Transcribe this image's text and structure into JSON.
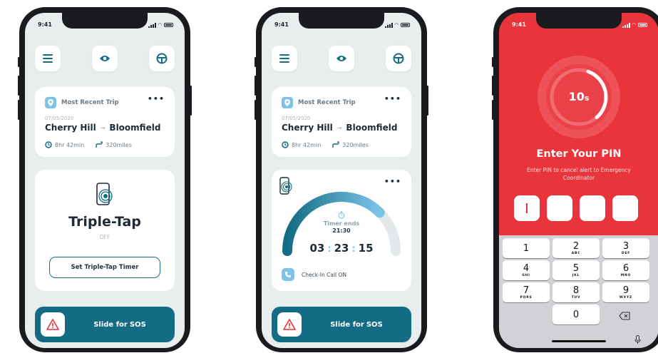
{
  "status": {
    "time": "9:41"
  },
  "screen1": {
    "trip": {
      "heading": "Most Recent Trip",
      "menu": "•••",
      "date": "07/05/2020",
      "from": "Cherry Hill",
      "arrow": "→",
      "to": "Bloomfield",
      "duration": "8hr 42min",
      "distance": "320miles"
    },
    "feature": {
      "title": "Triple-Tap",
      "state": "OFF",
      "button_label": "Set Triple-Tap Timer"
    },
    "sos": {
      "label_prefix": "Slide for",
      "label_bold": "SOS"
    }
  },
  "screen2": {
    "trip": {
      "heading": "Most Recent Trip",
      "menu": "•••",
      "date": "07/05/2020",
      "from": "Cherry Hill",
      "arrow": "→",
      "to": "Bloomfield",
      "duration": "8hr 42min",
      "distance": "320miles"
    },
    "timer": {
      "menu": "•••",
      "ends_label": "Timer ends",
      "ends_time": "21:30",
      "hours": "03",
      "minutes": "23",
      "seconds": "15",
      "progress_fraction": 0.75,
      "checkin_label": "Check-In Call ON"
    },
    "sos": {
      "label_prefix": "Slide for",
      "label_bold": "SOS"
    }
  },
  "screen3": {
    "countdown_value": "10",
    "countdown_unit": "s",
    "countdown_fraction": 0.33,
    "title": "Enter Your PIN",
    "subtitle": "Enter PIN to cancel alert to Emergency Coordinator",
    "keypad": [
      {
        "n": "1",
        "l": ""
      },
      {
        "n": "2",
        "l": "ABC"
      },
      {
        "n": "3",
        "l": "DEF"
      },
      {
        "n": "4",
        "l": "GHI"
      },
      {
        "n": "5",
        "l": "JKL"
      },
      {
        "n": "6",
        "l": "MNO"
      },
      {
        "n": "7",
        "l": "PQRS"
      },
      {
        "n": "8",
        "l": "TUV"
      },
      {
        "n": "9",
        "l": "WXYZ"
      },
      {
        "n": "0",
        "l": ""
      }
    ]
  },
  "colors": {
    "teal": "#136c83",
    "accent_blue": "#7cc3e8",
    "alert_red": "#e8343a",
    "screen_bg": "#e8eeee"
  },
  "icons": [
    "menu-icon",
    "eye-icon",
    "steering-wheel-icon",
    "location-pin-icon",
    "clock-icon",
    "route-icon",
    "phone-tap-icon",
    "warning-icon",
    "phone-call-icon",
    "stopwatch-icon",
    "backspace-icon",
    "microphone-icon"
  ]
}
